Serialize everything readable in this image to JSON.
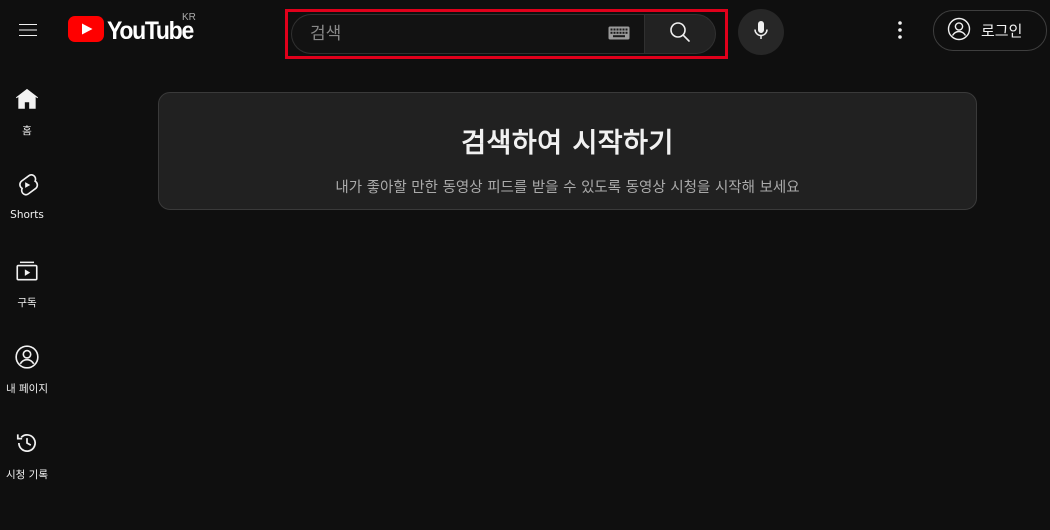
{
  "header": {
    "logo_text": "YouTube",
    "country_code": "KR",
    "search": {
      "placeholder": "검색",
      "value": ""
    },
    "signin_label": "로그인"
  },
  "sidebar": {
    "items": [
      {
        "label": "홈",
        "icon": "home-icon"
      },
      {
        "label": "Shorts",
        "icon": "shorts-icon"
      },
      {
        "label": "구독",
        "icon": "subscriptions-icon"
      },
      {
        "label": "내 페이지",
        "icon": "account-icon"
      },
      {
        "label": "시청 기록",
        "icon": "history-icon"
      }
    ]
  },
  "main": {
    "title": "검색하여 시작하기",
    "subtitle": "내가 좋아할 만한 동영상 피드를 받을 수 있도록 동영상 시청을 시작해 보세요"
  },
  "colors": {
    "background": "#0f0f0f",
    "brand_red": "#ff0000",
    "highlight_border": "#e0001b",
    "card": "#212121"
  }
}
